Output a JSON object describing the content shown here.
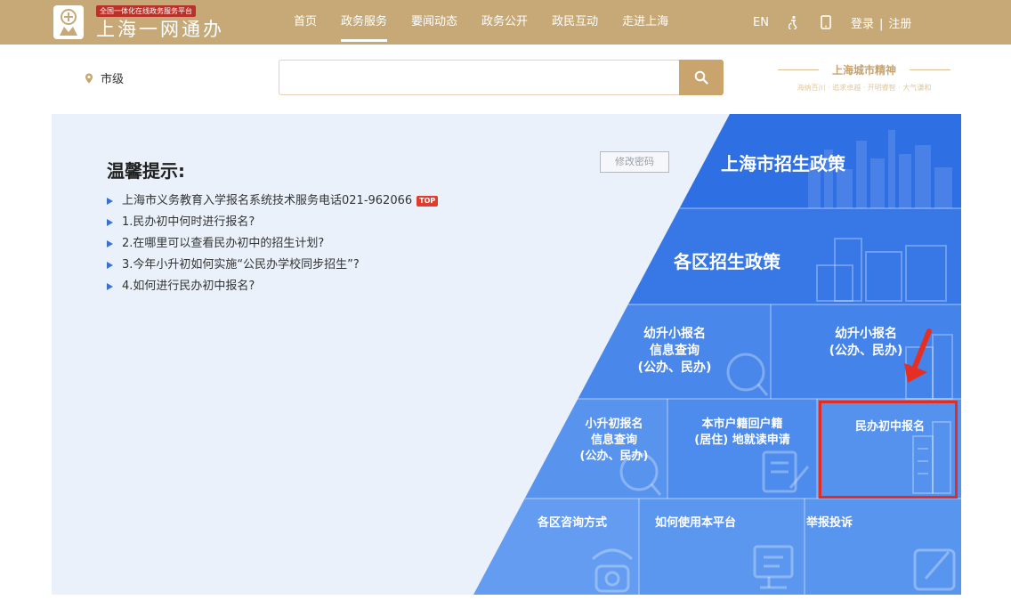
{
  "header": {
    "logo_badge": "全国一体化在线政务服务平台",
    "logo_title": "上海一网通办",
    "nav": [
      "首页",
      "政务服务",
      "要闻动态",
      "政务公开",
      "政民互动",
      "走进上海"
    ],
    "nav_active_index": 1,
    "lang": "EN",
    "login": "登录",
    "register": "注册",
    "login_sep": "|"
  },
  "search": {
    "location": "市级",
    "placeholder": "",
    "spirit_title": "上海城市精神",
    "spirit_sub": "海纳百川 · 追求卓越 · 开明睿智 · 大气谦和"
  },
  "tips": {
    "title": "温馨提示:",
    "top_badge": "TOP",
    "items": [
      "上海市义务教育入学报名系统技术服务电话021-962066",
      "1.民办初中何时进行报名?",
      "2.在哪里可以查看民办初中的招生计划?",
      "3.今年小升初如何实施“公民办学校同步招生”?",
      "4.如何进行民办初中报名?"
    ],
    "change_password": "修改密码"
  },
  "tiles": {
    "city_policy": "上海市招生政策",
    "district_policy": "各区招生政策",
    "k_to_p_query": [
      "幼升小报名",
      "信息查询",
      "(公办、民办)"
    ],
    "k_to_p_register": [
      "幼升小报名",
      "(公办、民办)"
    ],
    "p_to_m_query": [
      "小升初报名",
      "信息查询",
      "(公办、民办)"
    ],
    "hukou_apply": [
      "本市户籍回户籍",
      "(居住) 地就读申请"
    ],
    "private_middle": "民办初中报名",
    "district_contact": "各区咨询方式",
    "how_to_use": "如何使用本平台",
    "complaint": "举报投诉"
  },
  "colors": {
    "header_bg": "#c7a977",
    "tile_blue": "#3a78e6",
    "highlight_red": "#e12d24"
  }
}
